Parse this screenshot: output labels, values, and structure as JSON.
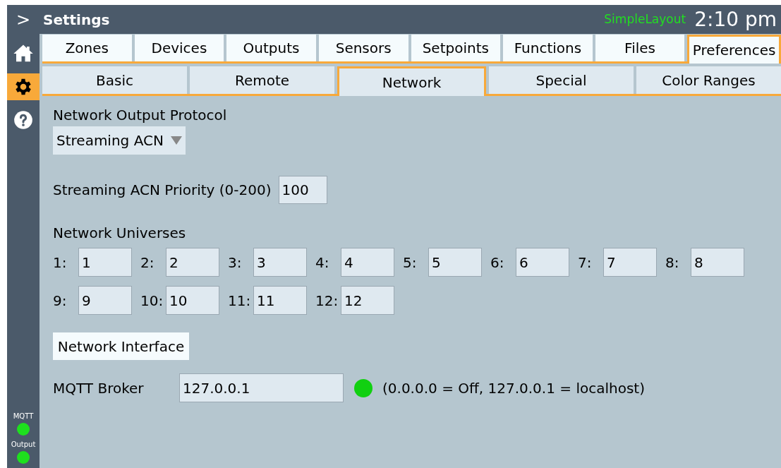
{
  "header": {
    "menu_glyph": ">",
    "title": "Settings",
    "layout": "SimpleLayout",
    "time": "2:10 pm"
  },
  "sidebar": {
    "items": [
      {
        "kind": "home",
        "selected": false
      },
      {
        "kind": "settings",
        "selected": true
      },
      {
        "kind": "help",
        "selected": false
      }
    ],
    "indicators": [
      {
        "label": "MQTT",
        "color": "#1ee01e"
      },
      {
        "label": "Output",
        "color": "#1ee01e"
      }
    ]
  },
  "main_tabs": [
    {
      "label": "Zones",
      "selected": false
    },
    {
      "label": "Devices",
      "selected": false
    },
    {
      "label": "Outputs",
      "selected": false
    },
    {
      "label": "Sensors",
      "selected": false
    },
    {
      "label": "Setpoints",
      "selected": false
    },
    {
      "label": "Functions",
      "selected": false
    },
    {
      "label": "Files",
      "selected": false
    },
    {
      "label": "Preferences",
      "selected": true
    }
  ],
  "sub_tabs": [
    {
      "label": "Basic",
      "selected": false
    },
    {
      "label": "Remote",
      "selected": false
    },
    {
      "label": "Network",
      "selected": true
    },
    {
      "label": "Special",
      "selected": false
    },
    {
      "label": "Color Ranges",
      "selected": false
    }
  ],
  "protocol": {
    "label": "Network Output Protocol",
    "value": "Streaming ACN"
  },
  "priority": {
    "label": "Streaming ACN Priority (0-200)",
    "value": "100"
  },
  "universes": {
    "label": "Network Universes",
    "items": [
      {
        "label": "1:",
        "value": "1"
      },
      {
        "label": "2:",
        "value": "2"
      },
      {
        "label": "3:",
        "value": "3"
      },
      {
        "label": "4:",
        "value": "4"
      },
      {
        "label": "5:",
        "value": "5"
      },
      {
        "label": "6:",
        "value": "6"
      },
      {
        "label": "7:",
        "value": "7"
      },
      {
        "label": "8:",
        "value": "8"
      },
      {
        "label": "9:",
        "value": "9"
      },
      {
        "label": "10:",
        "value": "10"
      },
      {
        "label": "11:",
        "value": "11"
      },
      {
        "label": "12:",
        "value": "12"
      }
    ]
  },
  "network_interface_button": "Network Interface",
  "mqtt": {
    "label": "MQTT Broker",
    "value": "127.0.0.1",
    "color": "#11d011",
    "hint": "(0.0.0.0 = Off, 127.0.0.1 = localhost)"
  }
}
